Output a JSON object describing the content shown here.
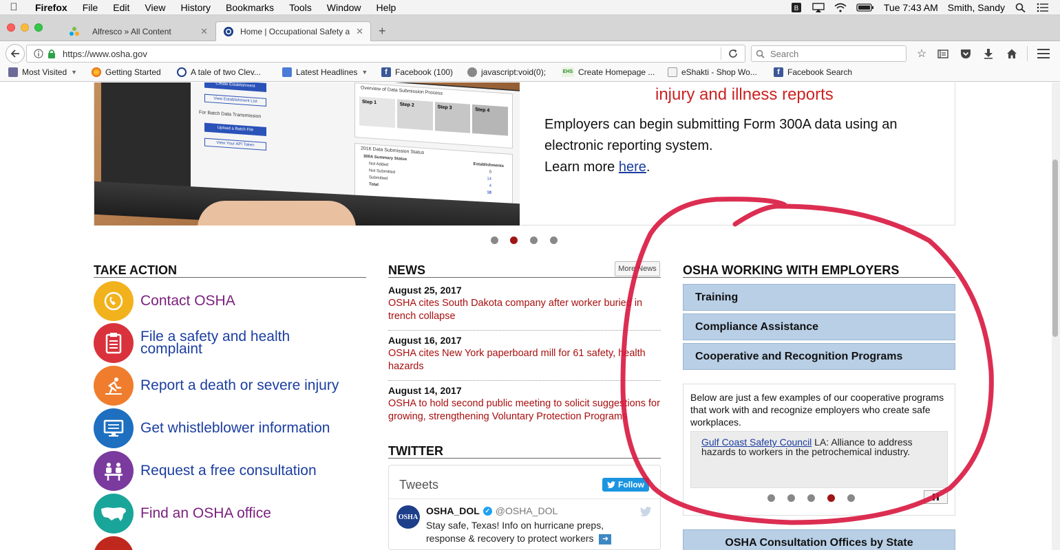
{
  "menubar": {
    "app_name": "Firefox",
    "menus": [
      "File",
      "Edit",
      "View",
      "History",
      "Bookmarks",
      "Tools",
      "Window",
      "Help"
    ],
    "clock": "Tue 7:43 AM",
    "user": "Smith, Sandy"
  },
  "tabs": [
    {
      "title": "Alfresco » All Content",
      "active": false
    },
    {
      "title": "Home | Occupational Safety a",
      "active": true
    }
  ],
  "navbar": {
    "url": "https://www.osha.gov",
    "search_placeholder": "Search"
  },
  "bookmarks": [
    {
      "label": "Most Visited",
      "dropdown": true
    },
    {
      "label": "Getting Started"
    },
    {
      "label": "A tale of two Clev..."
    },
    {
      "label": "Latest Headlines",
      "dropdown": true
    },
    {
      "label": "Facebook (100)"
    },
    {
      "label": "javascript:void(0);"
    },
    {
      "label": "Create Homepage ..."
    },
    {
      "label": "eShakti - Shop Wo..."
    },
    {
      "label": "Facebook Search"
    }
  ],
  "hero": {
    "heading": "injury and illness reports",
    "text_line1": "Employers can begin submitting Form 300A data using an",
    "text_line2": "electronic reporting system.",
    "learn_prefix": "Learn more ",
    "learn_link": "here",
    "learn_suffix": ".",
    "screen": {
      "create_establishment": "Create Establishment",
      "view_establishment_list": "View Establishment List",
      "batch_heading": "For Batch Data Transmission",
      "upload_batch": "Upload a Batch File",
      "view_api_token": "View Your API Token",
      "overview_title": "Overview of Data Submission Process",
      "step1": "Step 1",
      "step2": "Step 2",
      "step3": "Step 3",
      "step4": "Step 4",
      "status_title": "2016 Data Submission Status",
      "summary_status": "300A Summary Status",
      "establishments": "Establishments",
      "not_added": "Not Added",
      "not_submitted": "Not Submitted",
      "submitted": "Submitted",
      "total": "Total",
      "values": [
        "0",
        "14",
        "4",
        "18"
      ]
    },
    "active_slide": 2,
    "slide_count": 4
  },
  "take_action": {
    "title": "TAKE ACTION",
    "items": [
      {
        "label": "Contact OSHA",
        "color": "#f2b21d",
        "icon": "phone-icon"
      },
      {
        "label": "File a safety and health complaint",
        "color": "#d9323c",
        "icon": "clipboard-icon"
      },
      {
        "label": "Report a death or severe injury",
        "color": "#ef7d2d",
        "icon": "fall-icon"
      },
      {
        "label": "Get whistleblower information",
        "color": "#1e6fc0",
        "icon": "monitor-icon"
      },
      {
        "label": "Request a free consultation",
        "color": "#7a3a9e",
        "icon": "meeting-icon"
      },
      {
        "label": "Find an OSHA office",
        "color": "#1aa59a",
        "icon": "usa-map-icon"
      }
    ]
  },
  "news": {
    "title": "NEWS",
    "more_label": "More News",
    "items": [
      {
        "date": "August 25, 2017",
        "text": "OSHA cites South Dakota company after worker buried in trench collapse"
      },
      {
        "date": "August 16, 2017",
        "text": "OSHA cites New York paperboard mill for 61 safety, health hazards"
      },
      {
        "date": "August 14, 2017",
        "text": "OSHA to hold second public meeting to solicit suggestions for growing, strengthening Voluntary Protection Programs"
      }
    ]
  },
  "twitter": {
    "title": "TWITTER",
    "tweets_label": "Tweets",
    "follow_label": "Follow",
    "handle_name": "OSHA_DOL",
    "handle": "@OSHA_DOL",
    "tweet_text": "Stay safe, Texas! Info on hurricane preps, response & recovery to protect workers",
    "logo_text": "OSHA"
  },
  "employers": {
    "title": "OSHA WORKING WITH EMPLOYERS",
    "buttons": [
      "Training",
      "Compliance Assistance",
      "Cooperative and Recognition Programs"
    ],
    "intro": "Below are just a few examples of our cooperative programs that work with and recognize employers who create safe workplaces.",
    "card_link": "Gulf Coast Safety Council",
    "card_text": " LA: Alliance to address hazards to workers in the petrochemical industry.",
    "active_dot": 3,
    "dot_count": 5,
    "consult_label": "OSHA Consultation Offices by State"
  },
  "colors": {
    "link_blue": "#1b3ea0",
    "news_red": "#a80f0f",
    "annotation_red": "#d8173f",
    "employer_button": "#b8cfe6"
  }
}
